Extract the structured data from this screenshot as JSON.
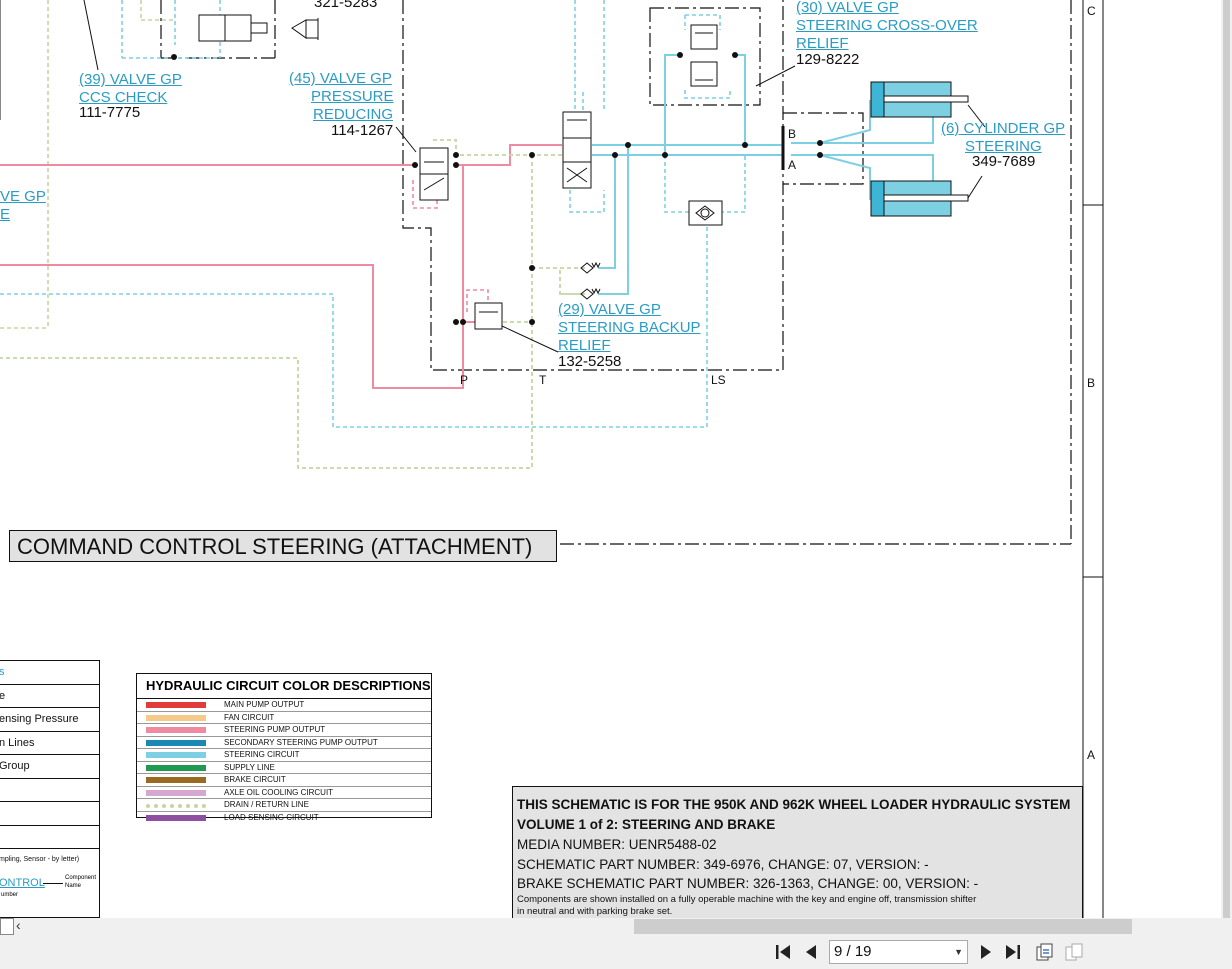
{
  "labels": {
    "valve39": {
      "l1": "(39) VALVE GP",
      "l2": "CCS CHECK",
      "pn": "111-7775"
    },
    "valve45": {
      "l1": "(45) VALVE GP",
      "l2": "PRESSURE",
      "l3": "REDUCING",
      "pn": "114-1267"
    },
    "valve30": {
      "l1": "(30) VALVE GP",
      "l2": "STEERING CROSS-OVER",
      "l3": "RELIEF",
      "pn": "129-8222"
    },
    "cyl6": {
      "l1": "(6) CYLINDER GP",
      "l2": "STEERING",
      "pn": "349-7689"
    },
    "valve29": {
      "l1": "(29) VALVE GP",
      "l2": "STEERING BACKUP",
      "l3": "RELIEF",
      "pn": "132-5258"
    },
    "partial_top": "321-5283",
    "partial_left1": "VE GP",
    "partial_left2": "E"
  },
  "ports": {
    "p": "P",
    "t": "T",
    "ls": "LS",
    "a": "A",
    "b": "B"
  },
  "zones": {
    "c": "C",
    "b": "B",
    "a": "A"
  },
  "title": "COMMAND CONTROL STEERING (ATTACHMENT)",
  "legend": {
    "title": "HYDRAULIC CIRCUIT COLOR DESCRIPTIONS",
    "items": [
      {
        "label": "MAIN PUMP OUTPUT",
        "color": "#e23b3b"
      },
      {
        "label": "FAN CIRCUIT",
        "color": "#f5c98a"
      },
      {
        "label": "STEERING PUMP OUTPUT",
        "color": "#ef8aa3"
      },
      {
        "label": "SECONDARY STEERING PUMP OUTPUT",
        "color": "#1a87b4"
      },
      {
        "label": "STEERING CIRCUIT",
        "color": "#7dd0e2"
      },
      {
        "label": "SUPPLY LINE",
        "color": "#1f9a50"
      },
      {
        "label": "BRAKE CIRCUIT",
        "color": "#9a6a22"
      },
      {
        "label": "AXLE OIL COOLING CIRCUIT",
        "color": "#d4a8d1"
      },
      {
        "label": "DRAIN / RETURN LINE",
        "color": "#c5d6a4"
      },
      {
        "label": "LOAD SENSING CIRCUIT",
        "color": "#8e4fa0"
      }
    ]
  },
  "left_table": {
    "rows": [
      "s",
      "e",
      "ensing Pressure",
      "n Lines",
      "Group",
      "",
      "",
      "",
      "mpling, Sensor - by letter)"
    ],
    "control_link": "ONTROL",
    "component_name": "Component Name",
    "number": "umber"
  },
  "info": {
    "line1": "THIS SCHEMATIC IS FOR THE 950K AND 962K WHEEL LOADER HYDRAULIC SYSTEM",
    "line2": "VOLUME 1 of 2: STEERING AND BRAKE",
    "line3": "MEDIA NUMBER: UENR5488-02",
    "line4": "SCHEMATIC PART NUMBER: 349-6976, CHANGE: 07, VERSION: -",
    "line5": "BRAKE SCHEMATIC PART NUMBER: 326-1363, CHANGE: 00, VERSION: -",
    "line6": "Components are shown installed on a fully operable machine with the key and engine off, transmission shifter",
    "line7": "in neutral and with parking brake set."
  },
  "nav": {
    "page": "9 / 19"
  },
  "icons": [
    "first-page-icon",
    "prev-page-icon",
    "next-page-icon",
    "last-page-icon",
    "fit-page-icon",
    "two-page-icon"
  ]
}
